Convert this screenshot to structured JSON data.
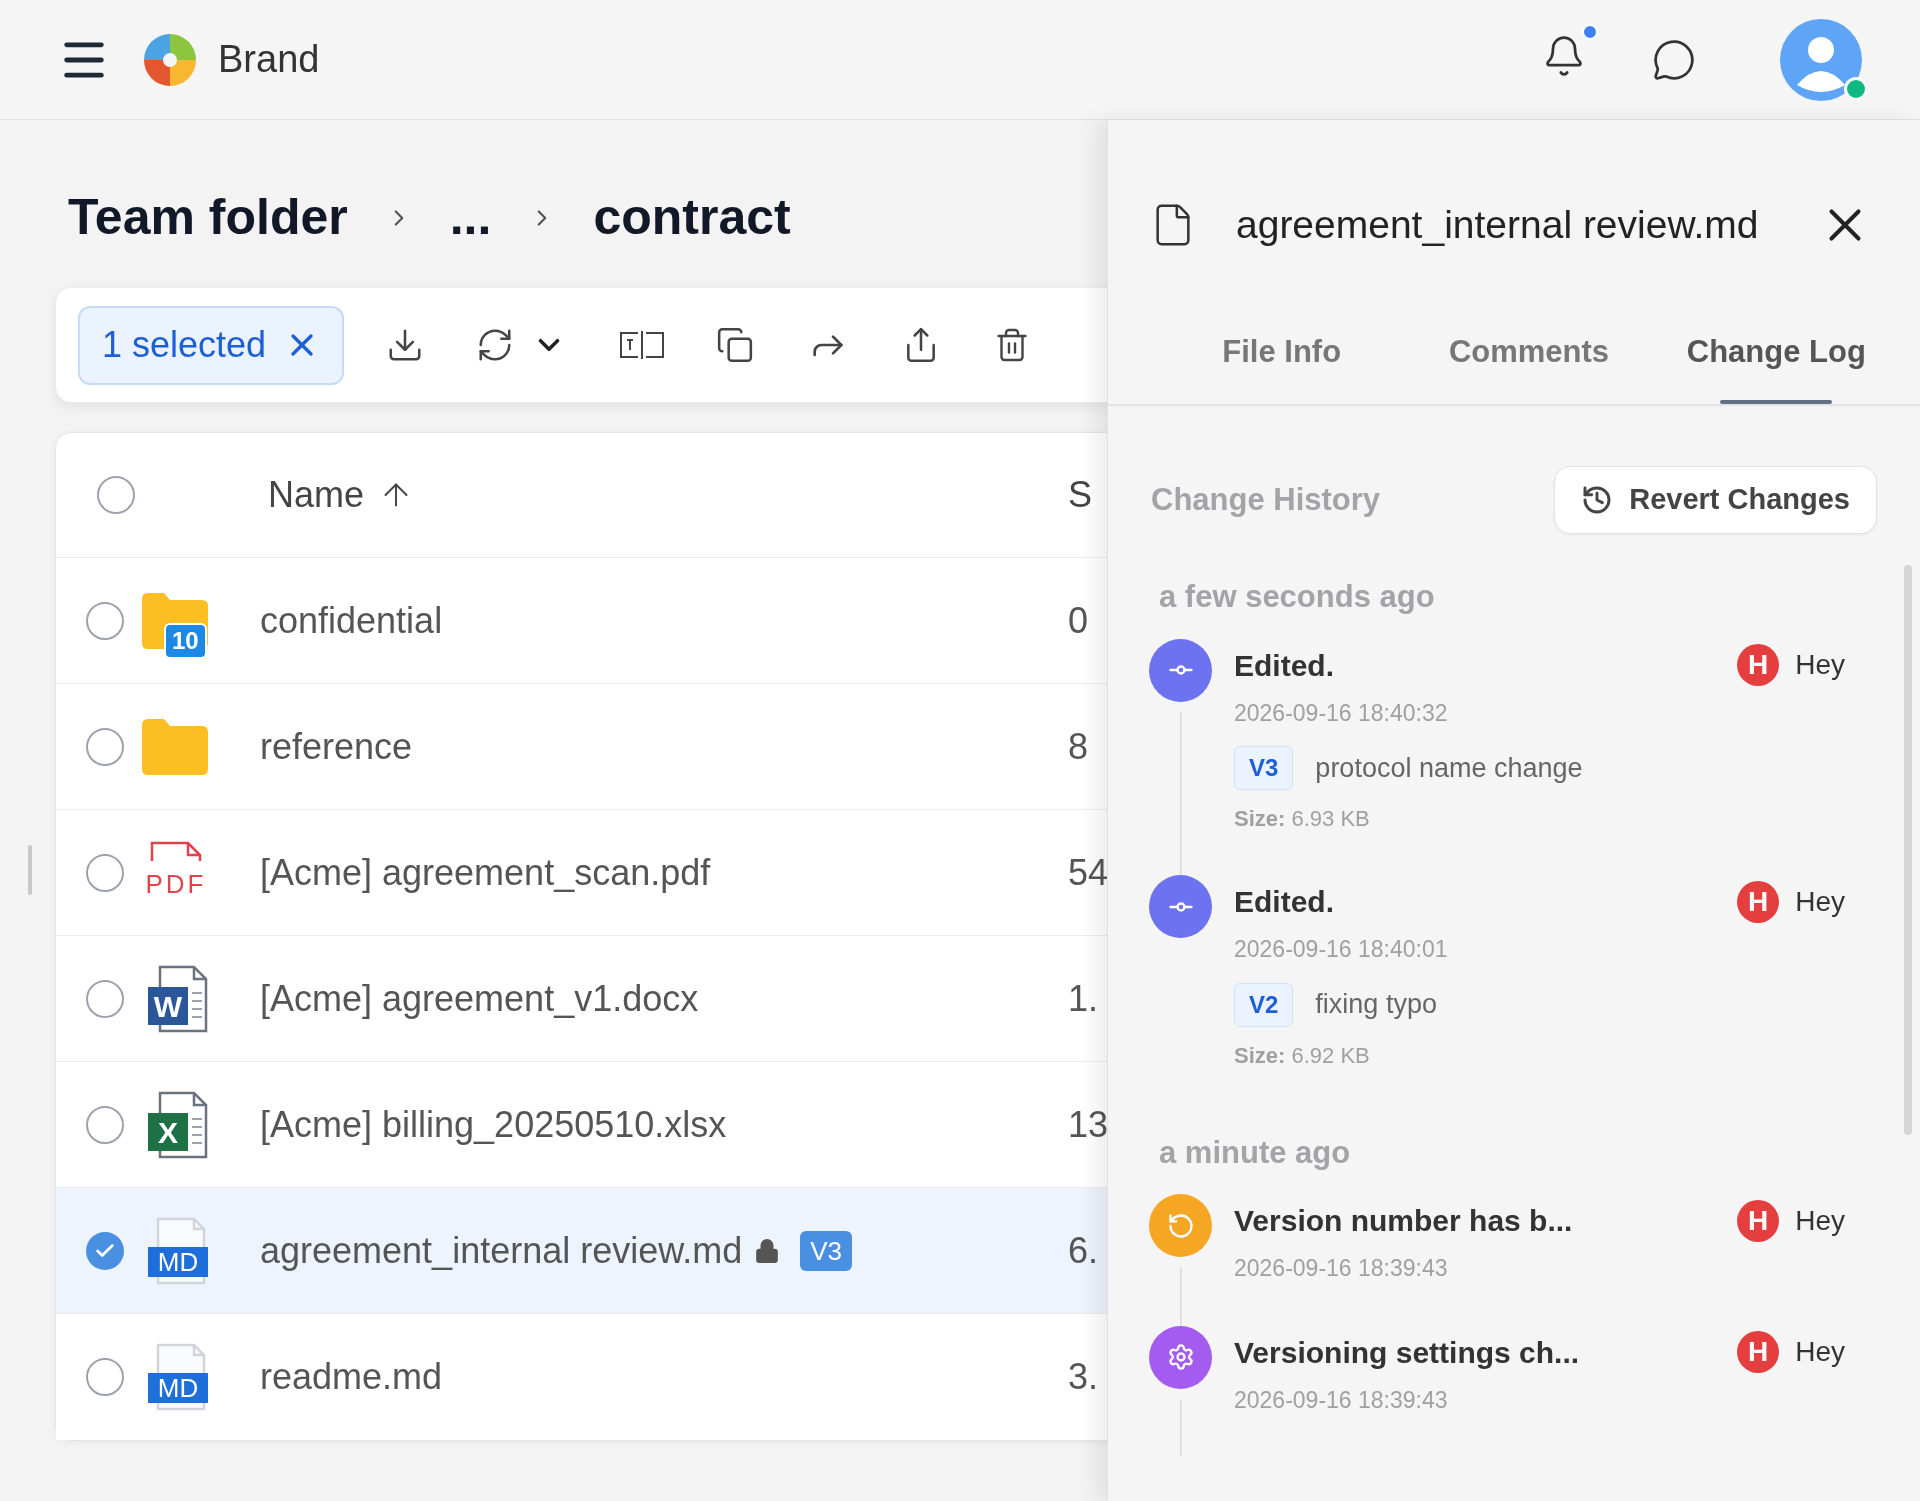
{
  "header": {
    "brand": "Brand",
    "notifications_unread": true,
    "user_online": true
  },
  "breadcrumb": [
    {
      "label": "Team folder"
    },
    {
      "label": "..."
    },
    {
      "label": "contract"
    }
  ],
  "toolbar": {
    "selection": "1 selected"
  },
  "table": {
    "select_all": {
      "checked": false
    },
    "columns": [
      {
        "label": "Name",
        "sorted": true
      },
      {
        "label": "S"
      }
    ],
    "rows": [
      {
        "kind": "folder",
        "name": "confidential",
        "badge": "10",
        "size": "0",
        "selected": false
      },
      {
        "kind": "folder",
        "name": "reference",
        "size": "8",
        "selected": false
      },
      {
        "kind": "pdf",
        "icon_label": "PDF",
        "name": "[Acme] agreement_scan.pdf",
        "size": "54",
        "selected": false
      },
      {
        "kind": "word",
        "icon_label": "W",
        "name": "[Acme] agreement_v1.docx",
        "size": "1.",
        "selected": false
      },
      {
        "kind": "excel",
        "icon_label": "X",
        "name": "[Acme] billing_20250510.xlsx",
        "size": "13",
        "selected": false
      },
      {
        "kind": "markdown",
        "icon_label": "MD",
        "name": "agreement_internal review.md",
        "locked": true,
        "version": "V3",
        "size": "6.",
        "selected": true
      },
      {
        "kind": "markdown",
        "icon_label": "MD",
        "name": "readme.md",
        "size": "3.",
        "selected": false
      }
    ]
  },
  "panel": {
    "title": "agreement_internal review.md",
    "tabs": [
      {
        "label": "File Info",
        "selected": false
      },
      {
        "label": "Comments",
        "selected": false
      },
      {
        "label": "Change Log",
        "selected": true
      }
    ],
    "section_title": "Change History",
    "revert_button": "Revert Changes",
    "groups": [
      {
        "label": "a few seconds ago",
        "entries": [
          {
            "kind": "edit",
            "title": "Edited.",
            "time": "2026-09-16 18:40:32",
            "version": "V3",
            "note": "protocol name change",
            "size": "**Size:** 6.93 KB",
            "user_initial": "H",
            "user": "Hey"
          },
          {
            "kind": "edit",
            "title": "Edited.",
            "time": "2026-09-16 18:40:01",
            "version": "V2",
            "note": "fixing typo",
            "size": "**Size:** 6.92 KB",
            "user_initial": "H",
            "user": "Hey"
          }
        ]
      },
      {
        "label": "a minute ago",
        "entries": [
          {
            "kind": "revert",
            "title": "Version number has b...",
            "time": "2026-09-16 18:39:43",
            "user_initial": "H",
            "user": "Hey"
          },
          {
            "kind": "settings",
            "title": "Versioning settings ch...",
            "time": "2026-09-16 18:39:43",
            "user_initial": "H",
            "user": "Hey"
          }
        ]
      }
    ]
  }
}
